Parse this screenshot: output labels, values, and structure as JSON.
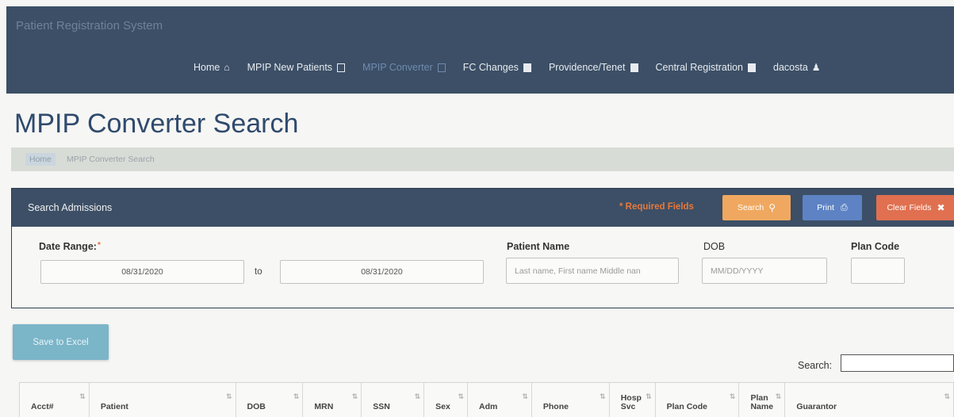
{
  "app": {
    "title": "Patient Registration System"
  },
  "nav": [
    {
      "label": "Home",
      "icon": "home-icon"
    },
    {
      "label": "MPIP New Patients",
      "icon": "calculator-icon"
    },
    {
      "label": "MPIP Converter",
      "icon": "calculator-icon",
      "active": true
    },
    {
      "label": "FC Changes",
      "icon": "book-icon"
    },
    {
      "label": "Providence/Tenet",
      "icon": "file-icon"
    },
    {
      "label": "Central Registration",
      "icon": "calendar-icon"
    },
    {
      "label": "dacosta",
      "icon": "user-icon"
    }
  ],
  "page": {
    "title": "MPIP Converter Search"
  },
  "breadcrumb": {
    "home": "Home",
    "current": "MPIP Converter Search"
  },
  "panel": {
    "title": "Search Admissions",
    "required_text": "* Required Fields",
    "buttons": {
      "search": "Search",
      "print": "Print",
      "clear": "Clear Fields"
    }
  },
  "form": {
    "date_range_label": "Date Range:",
    "date_from": "08/31/2020",
    "to_label": "to",
    "date_to": "08/31/2020",
    "patient_name_label": "Patient Name",
    "patient_name_placeholder": "Last name, First name Middle nan",
    "dob_label": "DOB",
    "dob_placeholder": "MM/DD/YYYY",
    "plan_code_label": "Plan Code",
    "plan_code_value": ""
  },
  "actions": {
    "save_excel": "Save to Excel"
  },
  "table": {
    "search_label": "Search:",
    "columns": [
      "Acct#",
      "Patient",
      "DOB",
      "MRN",
      "SSN",
      "Sex",
      "Adm",
      "Phone",
      "Hosp Svc",
      "Plan Code",
      "Plan Name",
      "Guarantor"
    ]
  },
  "colors": {
    "navbar": "#3c4f66",
    "title": "#2f4a6d",
    "search_button": "#f0a860",
    "print_button": "#5d83c4",
    "clear_button": "#e07050",
    "excel_button": "#7bb5c8"
  }
}
